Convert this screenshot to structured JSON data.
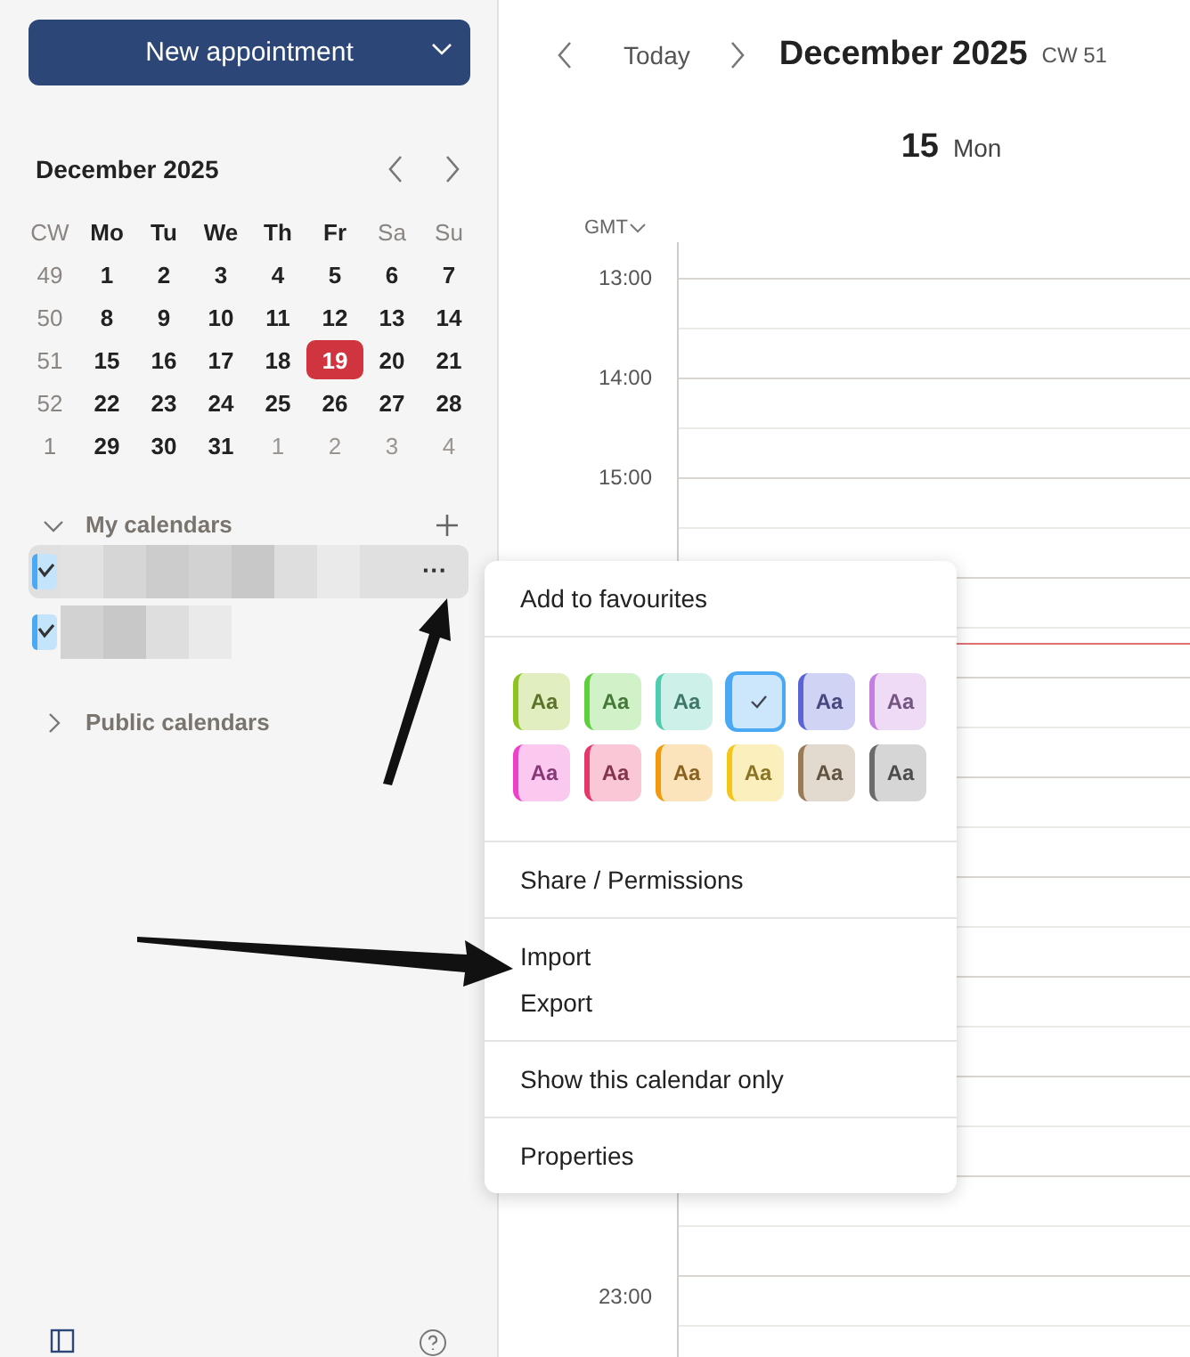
{
  "sidebar": {
    "new_button": {
      "label": "New appointment"
    },
    "mini_calendar": {
      "title": "December 2025",
      "headers": [
        {
          "label": "CW",
          "weekend": true
        },
        {
          "label": "Mo",
          "weekend": false
        },
        {
          "label": "Tu",
          "weekend": false
        },
        {
          "label": "We",
          "weekend": false
        },
        {
          "label": "Th",
          "weekend": false
        },
        {
          "label": "Fr",
          "weekend": false
        },
        {
          "label": "Sa",
          "weekend": true
        },
        {
          "label": "Su",
          "weekend": true
        }
      ],
      "weeks": [
        {
          "cw": "49",
          "days": [
            {
              "label": "1",
              "muted": false,
              "selected": false
            },
            {
              "label": "2",
              "muted": false,
              "selected": false
            },
            {
              "label": "3",
              "muted": false,
              "selected": false
            },
            {
              "label": "4",
              "muted": false,
              "selected": false
            },
            {
              "label": "5",
              "muted": false,
              "selected": false
            },
            {
              "label": "6",
              "muted": false,
              "selected": false
            },
            {
              "label": "7",
              "muted": false,
              "selected": false
            }
          ]
        },
        {
          "cw": "50",
          "days": [
            {
              "label": "8",
              "muted": false,
              "selected": false
            },
            {
              "label": "9",
              "muted": false,
              "selected": false
            },
            {
              "label": "10",
              "muted": false,
              "selected": false
            },
            {
              "label": "11",
              "muted": false,
              "selected": false
            },
            {
              "label": "12",
              "muted": false,
              "selected": false
            },
            {
              "label": "13",
              "muted": false,
              "selected": false
            },
            {
              "label": "14",
              "muted": false,
              "selected": false
            }
          ]
        },
        {
          "cw": "51",
          "days": [
            {
              "label": "15",
              "muted": false,
              "selected": false
            },
            {
              "label": "16",
              "muted": false,
              "selected": false
            },
            {
              "label": "17",
              "muted": false,
              "selected": false
            },
            {
              "label": "18",
              "muted": false,
              "selected": false
            },
            {
              "label": "19",
              "muted": false,
              "selected": true
            },
            {
              "label": "20",
              "muted": false,
              "selected": false
            },
            {
              "label": "21",
              "muted": false,
              "selected": false
            }
          ]
        },
        {
          "cw": "52",
          "days": [
            {
              "label": "22",
              "muted": false,
              "selected": false
            },
            {
              "label": "23",
              "muted": false,
              "selected": false
            },
            {
              "label": "24",
              "muted": false,
              "selected": false
            },
            {
              "label": "25",
              "muted": false,
              "selected": false
            },
            {
              "label": "26",
              "muted": false,
              "selected": false
            },
            {
              "label": "27",
              "muted": false,
              "selected": false
            },
            {
              "label": "28",
              "muted": false,
              "selected": false
            }
          ]
        },
        {
          "cw": "1",
          "days": [
            {
              "label": "29",
              "muted": false,
              "selected": false
            },
            {
              "label": "30",
              "muted": false,
              "selected": false
            },
            {
              "label": "31",
              "muted": false,
              "selected": false
            },
            {
              "label": "1",
              "muted": true,
              "selected": false
            },
            {
              "label": "2",
              "muted": true,
              "selected": false
            },
            {
              "label": "3",
              "muted": true,
              "selected": false
            },
            {
              "label": "4",
              "muted": true,
              "selected": false
            }
          ]
        }
      ]
    },
    "my_calendars": {
      "label": "My calendars",
      "expanded": true,
      "items": [
        {
          "checked": true,
          "selected": true,
          "more": "···"
        },
        {
          "checked": true,
          "selected": false
        }
      ]
    },
    "public_calendars": {
      "label": "Public calendars",
      "expanded": false
    }
  },
  "toolbar": {
    "today": "Today",
    "title": "December 2025",
    "week": "CW 51"
  },
  "day_header": {
    "number": "15",
    "weekday": "Mon"
  },
  "timezone": "GMT",
  "time_axis": {
    "upper": [
      "13:00",
      "14:00",
      "15:00"
    ],
    "lower": [
      "23:00"
    ]
  },
  "menu": {
    "items_top": [
      "Add to favourites"
    ],
    "colors": [
      {
        "color": "#8fc31f",
        "label": "Aa",
        "selected": false
      },
      {
        "color": "#5ccf3c",
        "label": "Aa",
        "selected": false
      },
      {
        "color": "#4ecbb0",
        "label": "Aa",
        "selected": false
      },
      {
        "color": "#4aa8f5",
        "selected": true
      },
      {
        "color": "#5b63d8",
        "label": "Aa",
        "selected": false
      },
      {
        "color": "#c57ee0",
        "label": "Aa",
        "selected": false
      },
      {
        "color": "#f03fc8",
        "label": "Aa",
        "selected": false
      },
      {
        "color": "#e8366a",
        "label": "Aa",
        "selected": false
      },
      {
        "color": "#f29a0b",
        "label": "Aa",
        "selected": false
      },
      {
        "color": "#f5c518",
        "label": "Aa",
        "selected": false
      },
      {
        "color": "#9a7b55",
        "label": "Aa",
        "selected": false
      },
      {
        "color": "#6b6b6b",
        "label": "Aa",
        "selected": false
      }
    ],
    "groups": [
      [
        "Share / Permissions"
      ],
      [
        "Import",
        "Export"
      ],
      [
        "Show this calendar only"
      ],
      [
        "Properties"
      ]
    ]
  }
}
